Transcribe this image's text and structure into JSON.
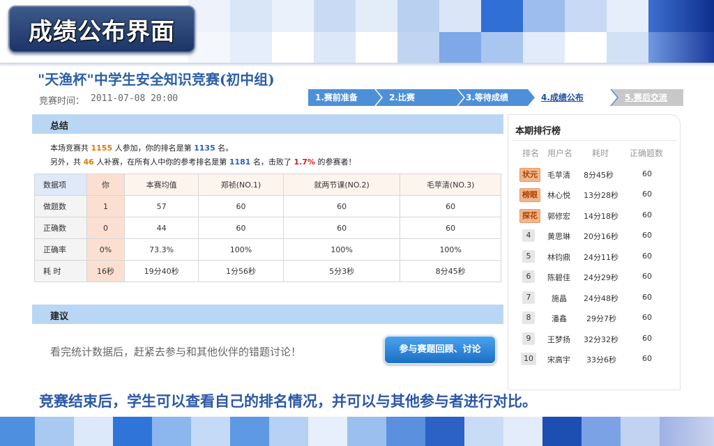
{
  "slide_title": "成绩公布界面",
  "contest": {
    "title": "\"天渔杯\"中学生安全知识竞赛(初中组)",
    "time_label": "竞赛时间：",
    "time": "2011-07-08 20:00"
  },
  "steps": [
    {
      "label": "1.赛前准备",
      "state": "done"
    },
    {
      "label": "2.比赛",
      "state": "done"
    },
    {
      "label": "3.等待成绩",
      "state": "done"
    },
    {
      "label": "4.成绩公布",
      "state": "current"
    },
    {
      "label": "5.赛后交流",
      "state": "todo"
    }
  ],
  "summary": {
    "heading": "总结",
    "line1": {
      "p1": "本场竞赛共",
      "total": "1155",
      "p2": "人参加，你的排名是第",
      "rank": "1135",
      "p3": "名。"
    },
    "line2": {
      "p1": "另外，共",
      "makeup": "46",
      "p2": "人补赛，在所有人中你的参考排名是第",
      "ref_rank": "1181",
      "p3": "名，击败了",
      "beat": "1.7%",
      "p4": "的参赛者！"
    }
  },
  "table": {
    "headers": [
      "数据项",
      "你",
      "本赛均值",
      "郑祯(NO.1)",
      "就两节课(NO.2)",
      "毛苹清(NO.3)"
    ],
    "rows": [
      [
        "做题数",
        "1",
        "57",
        "60",
        "60",
        "60"
      ],
      [
        "正确数",
        "0",
        "44",
        "60",
        "60",
        "60"
      ],
      [
        "正确率",
        "0%",
        "73.3%",
        "100%",
        "100%",
        "100%"
      ],
      [
        "耗 时",
        "16秒",
        "19分40秒",
        "1分56秒",
        "5分3秒",
        "8分45秒"
      ]
    ]
  },
  "advice": {
    "heading": "建议",
    "text": "看完统计数据后，赶紧去参与和其他伙伴的错题讨论！",
    "button": "参与赛题回顾、讨论"
  },
  "ranking": {
    "title": "本期排行榜",
    "headers": [
      "排名",
      "用户名",
      "耗时",
      "正确题数"
    ],
    "rows": [
      {
        "rank": "状元",
        "user": "毛苹清",
        "time": "8分45秒",
        "correct": "60",
        "medal": true
      },
      {
        "rank": "榜眼",
        "user": "林心悦",
        "time": "13分28秒",
        "correct": "60",
        "medal": true
      },
      {
        "rank": "探花",
        "user": "郭修宏",
        "time": "14分18秒",
        "correct": "60",
        "medal": true
      },
      {
        "rank": "4",
        "user": "黄思琳",
        "time": "20分16秒",
        "correct": "60",
        "medal": false
      },
      {
        "rank": "5",
        "user": "林钧鼎",
        "time": "24分11秒",
        "correct": "60",
        "medal": false
      },
      {
        "rank": "6",
        "user": "陈碧佳",
        "time": "24分29秒",
        "correct": "60",
        "medal": false
      },
      {
        "rank": "7",
        "user": "施晶",
        "time": "24分48秒",
        "correct": "60",
        "medal": false
      },
      {
        "rank": "8",
        "user": "潘鑫",
        "time": "29分7秒",
        "correct": "60",
        "medal": false
      },
      {
        "rank": "9",
        "user": "王梦扬",
        "time": "32分32秒",
        "correct": "60",
        "medal": false
      },
      {
        "rank": "10",
        "user": "宋高宇",
        "time": "33分6秒",
        "correct": "60",
        "medal": false
      }
    ]
  },
  "caption": "竞赛结束后，学生可以查看自己的排名情况，并可以与其他参与者进行对比。",
  "colors": {
    "accent": "#2b5fa8",
    "section_bar": "#b9d7f4",
    "button": "#1c6fc4",
    "highlight_you": "#fbe0d2"
  }
}
